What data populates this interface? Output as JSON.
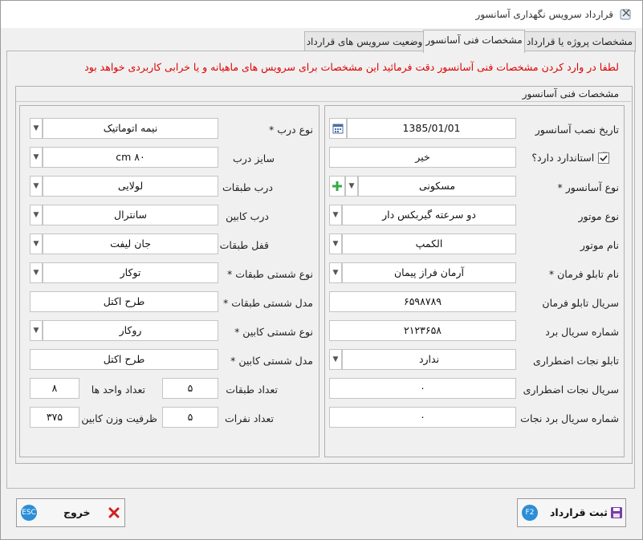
{
  "window": {
    "title": "قرارداد سرویس نگهداری آسانسور"
  },
  "tabs": [
    {
      "label": "مشخصات پروژه یا قرارداد",
      "active": false
    },
    {
      "label": "مشخصات فنی آسانسور",
      "active": true
    },
    {
      "label": "وضعیت سرویس های قرارداد",
      "active": false
    }
  ],
  "warning": "لطفا در وارد کردن مشخصات فنی آسانسور دقت فرمائید این مشخصات برای سرویس  های ماهیانه و یا خرابی کاربردی خواهد بود",
  "group_title": "مشخصات فنی آسانسور",
  "right_panel": {
    "install_date": {
      "label": "تاریخ نصب آسانسور",
      "value": "1385/01/01"
    },
    "has_standard": {
      "label": "آیا استاندارد دارد؟",
      "checked": true,
      "value": "خیر"
    },
    "elevator_type": {
      "label": "نوع آسانسور *",
      "value": "مسکونی"
    },
    "motor_type": {
      "label": "نوع موتور",
      "value": "دو سرعته گیربکس دار"
    },
    "motor_name": {
      "label": "نام موتور",
      "value": "الکمپ"
    },
    "control_panel_name": {
      "label": "نام تابلو فرمان *",
      "value": "آرمان فراز پیمان"
    },
    "control_panel_serial": {
      "label": "سریال تابلو فرمان",
      "value": "۶۵۹۸۷۸۹"
    },
    "board_serial": {
      "label": "شماره سریال برد",
      "value": "۲۱۲۳۶۵۸"
    },
    "emergency_panel": {
      "label": "تابلو نجات اضطراری",
      "value": "ندارد"
    },
    "emergency_serial": {
      "label": "سریال نجات اضطراری",
      "value": "۰"
    },
    "rescue_board_serial": {
      "label": "شماره سریال برد نجات",
      "value": "۰"
    }
  },
  "left_panel": {
    "door_type": {
      "label": "نوع درب *",
      "value": "نیمه اتوماتیک"
    },
    "door_size": {
      "label": "سایز درب",
      "value": "cm ۸۰"
    },
    "floor_door": {
      "label": "درب طبقات",
      "value": "لولایی"
    },
    "cabin_door": {
      "label": "درب کابین",
      "value": "سانترال"
    },
    "floor_lock": {
      "label": "قفل طبقات",
      "value": "جان لیفت"
    },
    "floor_cladding_type": {
      "label": "نوع شستی طبقات *",
      "value": "توکار"
    },
    "floor_cladding_model": {
      "label": "مدل شستی طبقات *",
      "value": "طرح اکتل"
    },
    "cabin_cladding_type": {
      "label": "نوع شستی کابین *",
      "value": "روکار"
    },
    "cabin_cladding_model": {
      "label": "مدل شستی کابین *",
      "value": "طرح اکتل"
    },
    "floors_count": {
      "label": "تعداد طبقات",
      "value": "۵"
    },
    "units_count": {
      "label": "تعداد واحد ها",
      "value": "۸"
    },
    "persons_count": {
      "label": "تعداد نفرات",
      "value": "۵"
    },
    "cabin_capacity": {
      "label": "ظرفیت وزن کابین",
      "value": "۳۷۵"
    }
  },
  "buttons": {
    "exit": {
      "label": "خروج",
      "key": "ESC"
    },
    "save": {
      "label": "ثبت قرارداد",
      "key": "F2"
    }
  },
  "colors": {
    "warning": "#e00000",
    "key_badge": "#2c8ed6",
    "exit_icon": "#d32020",
    "save_icon": "#7a3da8",
    "add_icon": "#3aa84a"
  }
}
